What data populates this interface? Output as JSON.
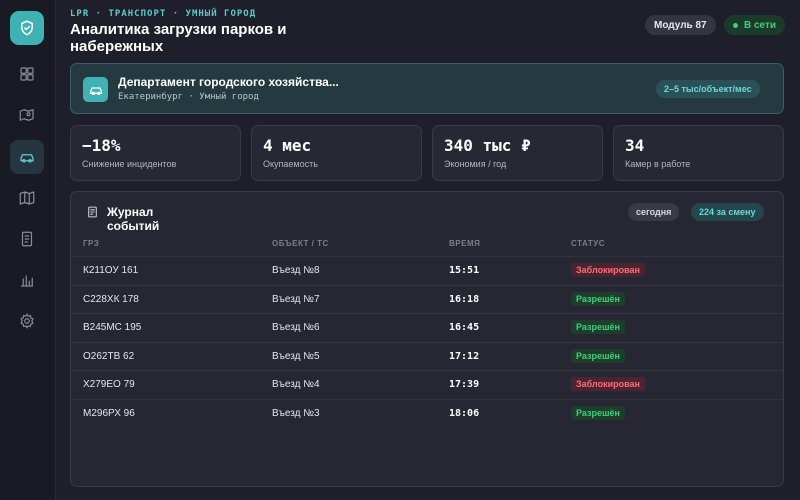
{
  "header": {
    "kicker": "LPR · ТРАНСПОРТ · УМНЫЙ ГОРОД",
    "title": "Аналитика загрузки парков и набережных",
    "module_label": "Модуль 87",
    "online_label": "В сети",
    "online_color": "#3ed07a"
  },
  "sidebar": {
    "items": [
      {
        "icon": "dashboard-icon"
      },
      {
        "icon": "map-location-icon"
      },
      {
        "icon": "car-icon",
        "active": true
      },
      {
        "icon": "map-icon"
      },
      {
        "icon": "document-icon"
      },
      {
        "icon": "bar-chart-icon"
      },
      {
        "icon": "settings-icon"
      }
    ]
  },
  "department": {
    "name": "Департамент городского хозяйства...",
    "subtitle": "Екатеринбург · Умный город",
    "rate": "2–5 тыс/объект/мес"
  },
  "stats": [
    {
      "value": "−18%",
      "label": "Снижение инцидентов"
    },
    {
      "value": "4 мес",
      "label": "Окупаемость"
    },
    {
      "value": "340 тыс ₽",
      "label": "Экономия / год"
    },
    {
      "value": "34",
      "label": "Камер в работе"
    }
  ],
  "journal": {
    "title": "Журнал событий",
    "today_label": "сегодня",
    "shift_label": "224 за смену",
    "columns": [
      "ГРЗ",
      "ОБЪЕКТ / ТС",
      "ВРЕМЯ",
      "СТАТУС"
    ],
    "rows": [
      {
        "plate": "К211ОУ 161",
        "object": "Въезд №8",
        "time": "15:51",
        "status": "Заблокирован",
        "kind": "blocked"
      },
      {
        "plate": "С228ХК 178",
        "object": "Въезд №7",
        "time": "16:18",
        "status": "Разрешён",
        "kind": "allowed"
      },
      {
        "plate": "В245МС 195",
        "object": "Въезд №6",
        "time": "16:45",
        "status": "Разрешён",
        "kind": "allowed"
      },
      {
        "plate": "О262ТВ 62",
        "object": "Въезд №5",
        "time": "17:12",
        "status": "Разрешён",
        "kind": "allowed"
      },
      {
        "plate": "Х279ЕО 79",
        "object": "Въезд №4",
        "time": "17:39",
        "status": "Заблокирован",
        "kind": "blocked"
      },
      {
        "plate": "М296РХ 96",
        "object": "Въезд №3",
        "time": "18:06",
        "status": "Разрешён",
        "kind": "allowed"
      }
    ]
  },
  "colors": {
    "accent": "#3fb3b3",
    "blocked": "#ff6b7a",
    "allowed": "#3ed07a"
  }
}
